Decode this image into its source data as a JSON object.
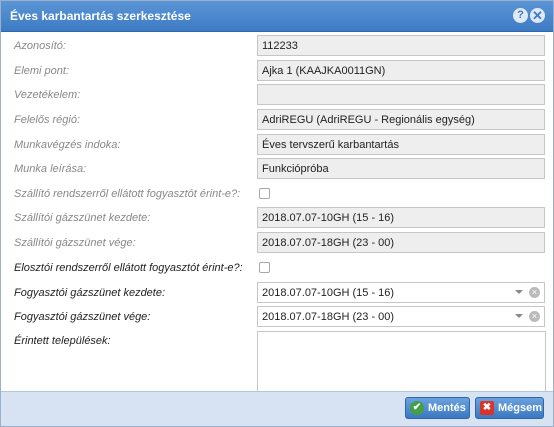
{
  "dialog": {
    "title": "Éves karbantartás szerkesztése",
    "help_icon": "?",
    "close_icon": "✕"
  },
  "fields": {
    "azonosito": {
      "label": "Azonosító:",
      "value": "112233"
    },
    "elemi_pont": {
      "label": "Elemi pont:",
      "value": "Ajka 1 (KAAJKA0011GN)"
    },
    "vezetekelem": {
      "label": "Vezetékelem:",
      "value": ""
    },
    "felelos_regio": {
      "label": "Felelős régió:",
      "value": "AdriREGU (AdriREGU - Regionális egység)"
    },
    "munkavegzes_indoka": {
      "label": "Munkavégzés indoka:",
      "value": "Éves tervszerű karbantartás"
    },
    "munka_leirasa": {
      "label": "Munka leírása:",
      "value": "Funkciópróba"
    },
    "szallito_erint": {
      "label": "Szállító rendszerről ellátott fogyasztót érint-e?:",
      "checked": false
    },
    "szallitoi_kezdete": {
      "label": "Szállítói gázszünet kezdete:",
      "value": "2018.07.07-10GH (15 - 16)"
    },
    "szallitoi_vege": {
      "label": "Szállítói gázszünet vége:",
      "value": "2018.07.07-18GH (23 - 00)"
    },
    "eloszto_erint": {
      "label": "Elosztói rendszerről ellátott fogyasztót érint-e?:",
      "checked": false
    },
    "fogyasztoi_kezdete": {
      "label": "Fogyasztói gázszünet kezdete:",
      "value": "2018.07.07-10GH (15 - 16)"
    },
    "fogyasztoi_vege": {
      "label": "Fogyasztói gázszünet vége:",
      "value": "2018.07.07-18GH (23 - 00)"
    },
    "erintett_telepulesek": {
      "label": "Érintett települések:",
      "value": ""
    }
  },
  "buttons": {
    "save_label": "Mentés",
    "cancel_label": "Mégsem"
  },
  "icons": {
    "dropdown": "chevron-down-icon",
    "clear": "clear-icon",
    "save": "check-icon",
    "cancel": "x-icon"
  },
  "colors": {
    "titlebar": "#3d7bc4",
    "footer": "#d7e3f2",
    "save_icon": "#43a047",
    "cancel_icon": "#d9342b"
  }
}
